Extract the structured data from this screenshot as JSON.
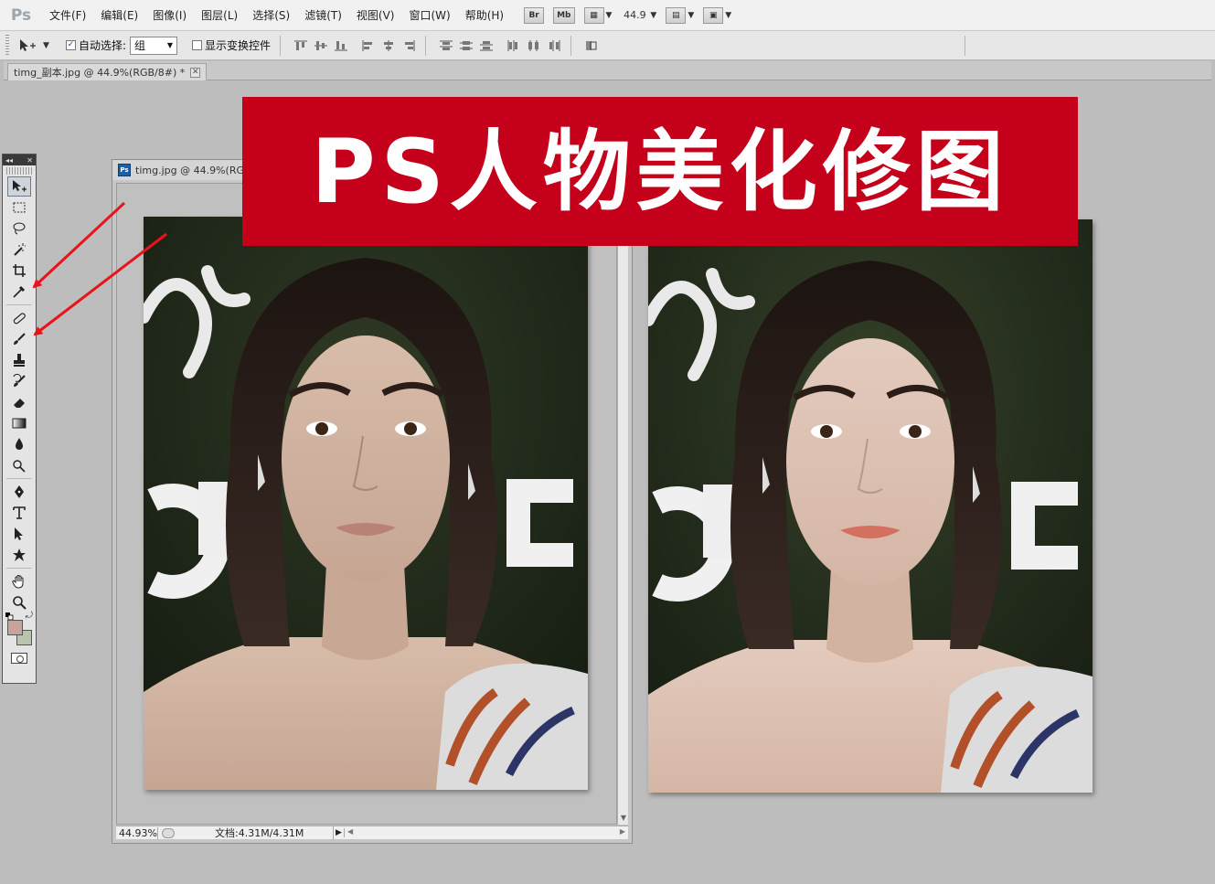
{
  "app": {
    "logo": "Ps"
  },
  "menu": [
    "文件(F)",
    "编辑(E)",
    "图像(I)",
    "图层(L)",
    "选择(S)",
    "滤镜(T)",
    "视图(V)",
    "窗口(W)",
    "帮助(H)"
  ],
  "menubar_tools": {
    "bridge": "Br",
    "mini_bridge": "Mb",
    "zoom_value": "44.9"
  },
  "options": {
    "auto_select_label": "自动选择:",
    "auto_select_checked": true,
    "auto_select_mode": "组",
    "show_transform_label": "显示变换控件",
    "show_transform_checked": false
  },
  "tab": {
    "title": "timg_副本.jpg @ 44.9%(RGB/8#) *"
  },
  "document": {
    "title": "timg.jpg @ 44.9%(RG",
    "status_zoom": "44.93%",
    "status_doc": "文档:4.31M/4.31M"
  },
  "banner": {
    "title": "PS人物美化修图"
  },
  "tools": [
    "move-tool",
    "marquee-tool",
    "lasso-tool",
    "quick-selection-tool",
    "crop-tool",
    "eyedropper-tool",
    "spot-healing-tool",
    "brush-tool",
    "clone-stamp-tool",
    "history-brush-tool",
    "eraser-tool",
    "gradient-tool",
    "blur-tool",
    "dodge-tool",
    "pen-tool",
    "type-tool",
    "path-selection-tool",
    "custom-shape-tool",
    "hand-tool",
    "zoom-tool"
  ],
  "colors": {
    "foreground": "#c7a49a",
    "background": "#b9c4ad",
    "banner": "#c4001a",
    "arrow": "#e8131b"
  }
}
